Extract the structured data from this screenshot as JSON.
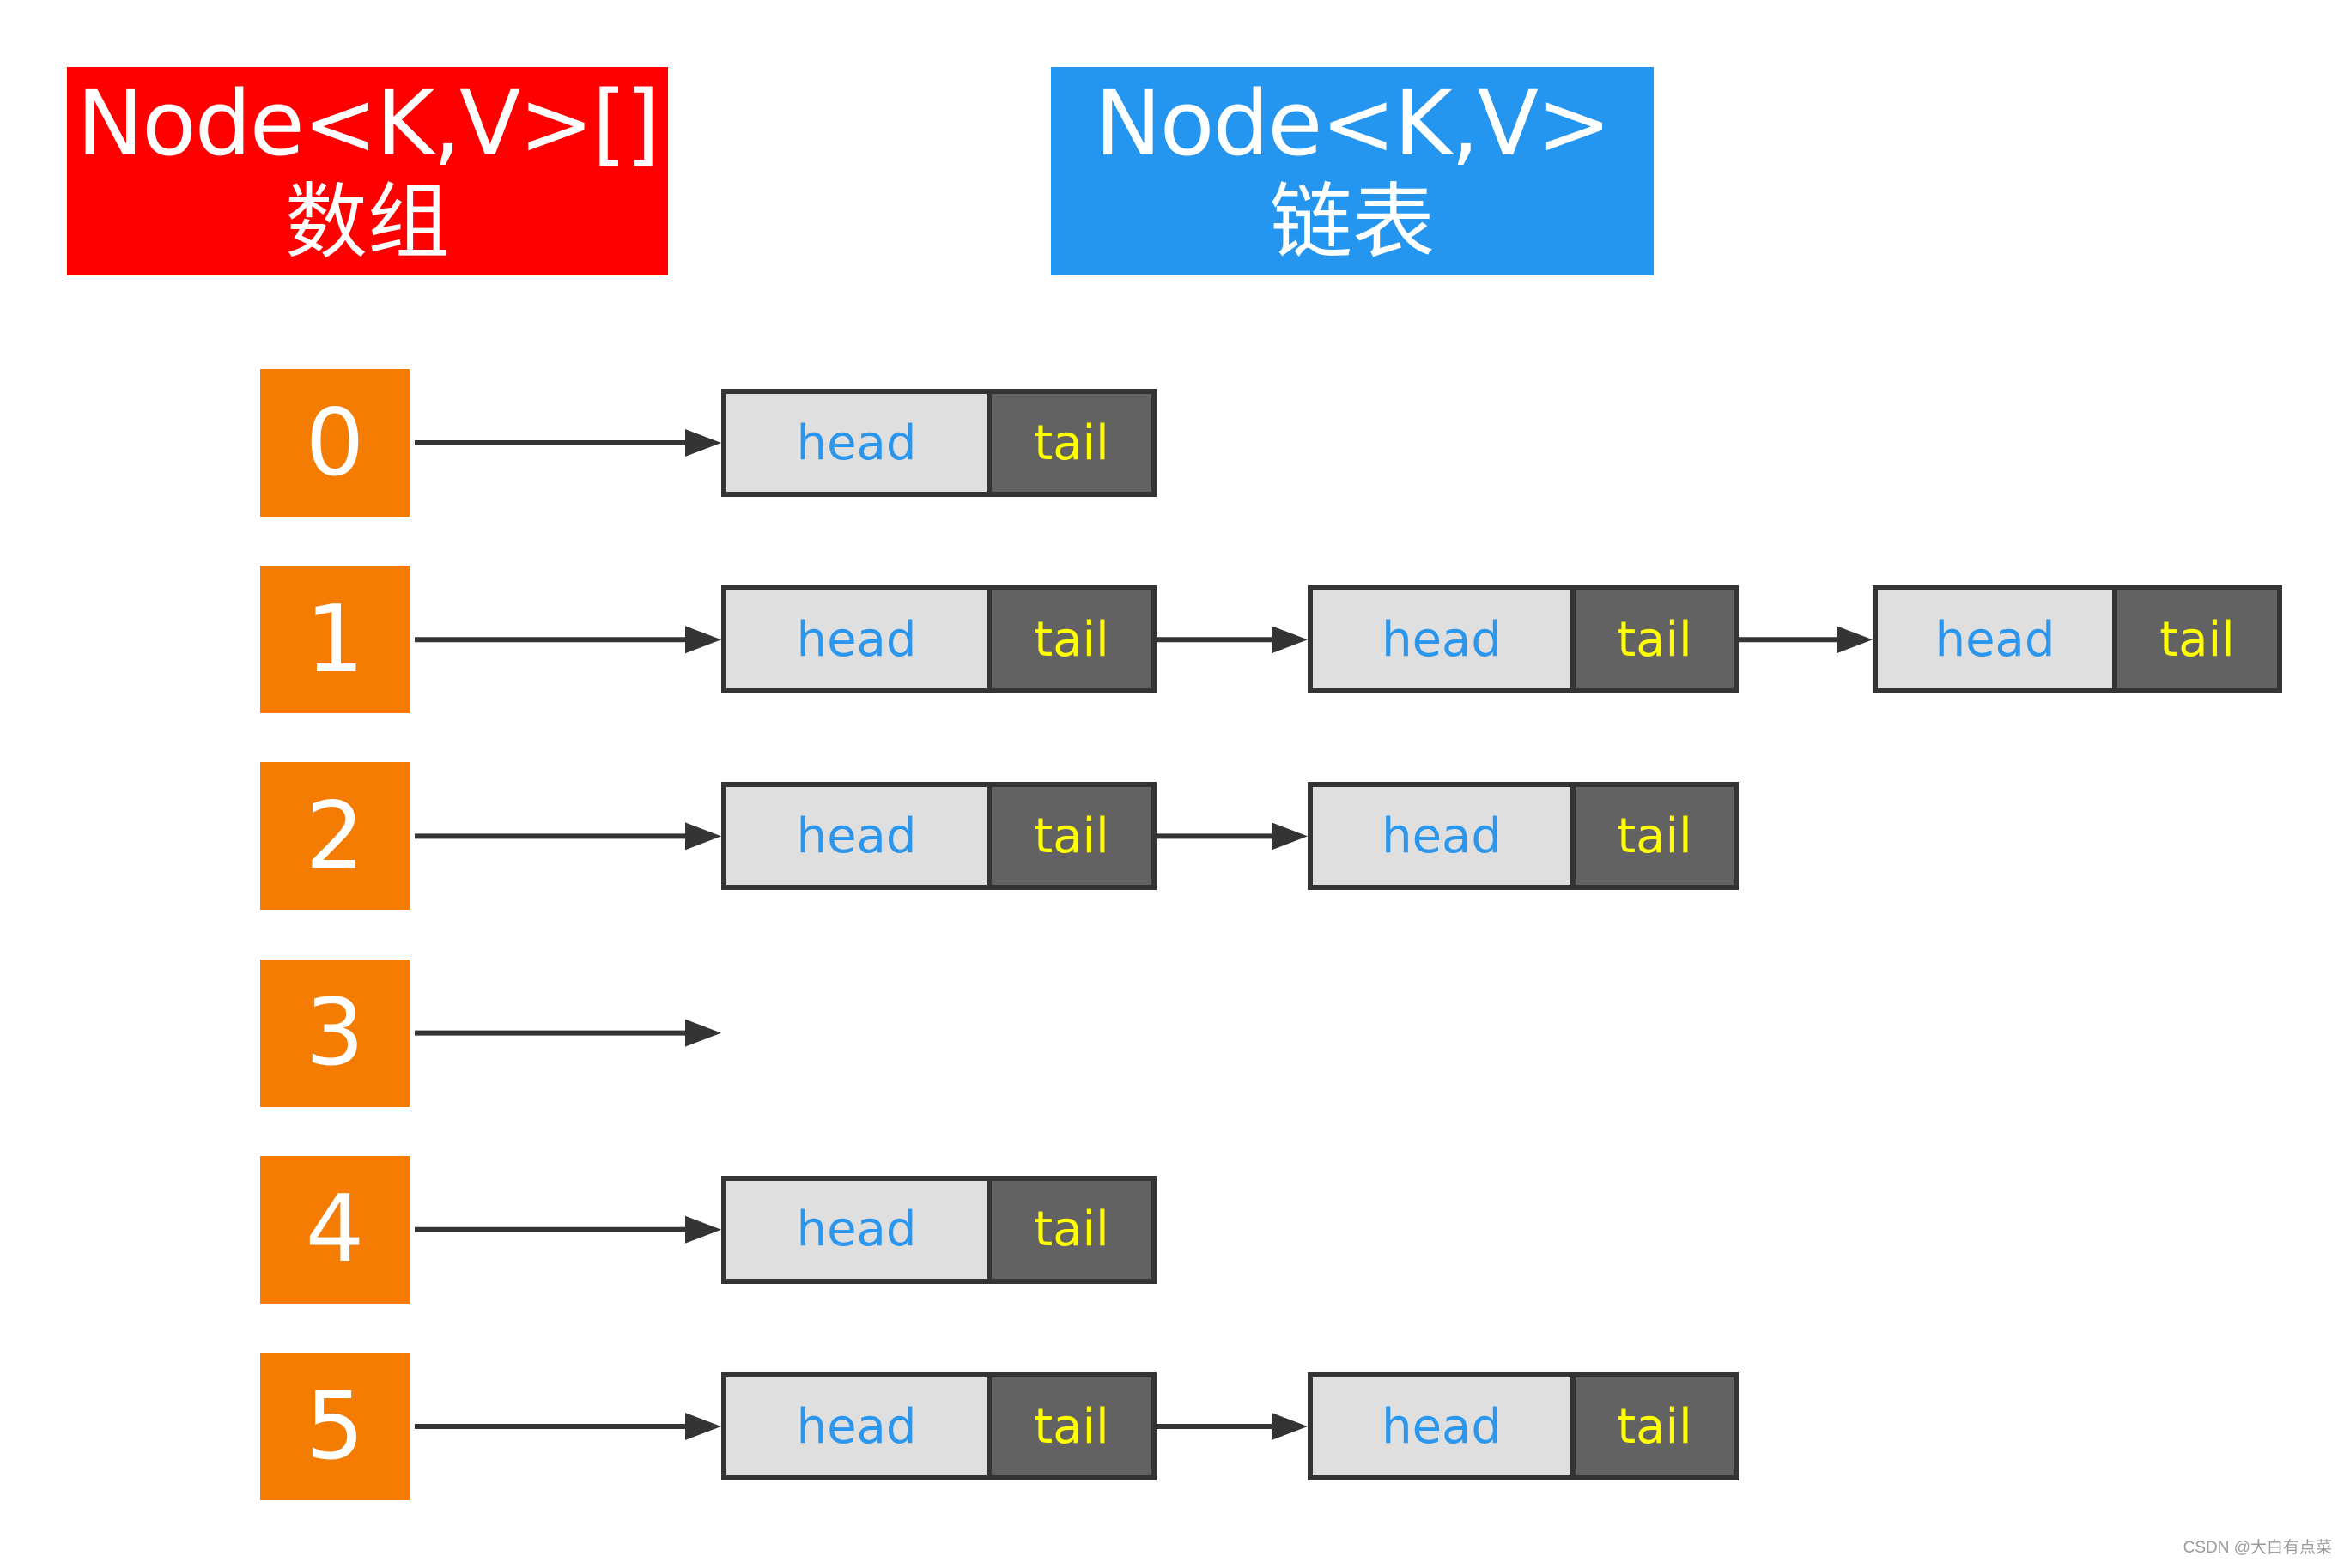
{
  "array_title": {
    "line1": "Node<K,V>[]",
    "line2": "数组",
    "color": "#fe0000"
  },
  "list_title": {
    "line1": "Node<K,V>",
    "line2": "链表",
    "color": "#2596f0"
  },
  "colors": {
    "index_box": "#f47c02",
    "head_fill": "#dfdfdf",
    "head_text": "#2a96ee",
    "tail_fill": "#626262",
    "tail_text": "#ffff00",
    "border": "#343434"
  },
  "buckets": [
    {
      "index": "0",
      "nodes": [
        {
          "head": "head",
          "tail": "tail"
        }
      ]
    },
    {
      "index": "1",
      "nodes": [
        {
          "head": "head",
          "tail": "tail"
        },
        {
          "head": "head",
          "tail": "tail"
        },
        {
          "head": "head",
          "tail": "tail"
        }
      ]
    },
    {
      "index": "2",
      "nodes": [
        {
          "head": "head",
          "tail": "tail"
        },
        {
          "head": "head",
          "tail": "tail"
        }
      ]
    },
    {
      "index": "3",
      "nodes": []
    },
    {
      "index": "4",
      "nodes": [
        {
          "head": "head",
          "tail": "tail"
        }
      ]
    },
    {
      "index": "5",
      "nodes": [
        {
          "head": "head",
          "tail": "tail"
        },
        {
          "head": "head",
          "tail": "tail"
        }
      ]
    }
  ],
  "watermark": "CSDN @大白有点菜"
}
